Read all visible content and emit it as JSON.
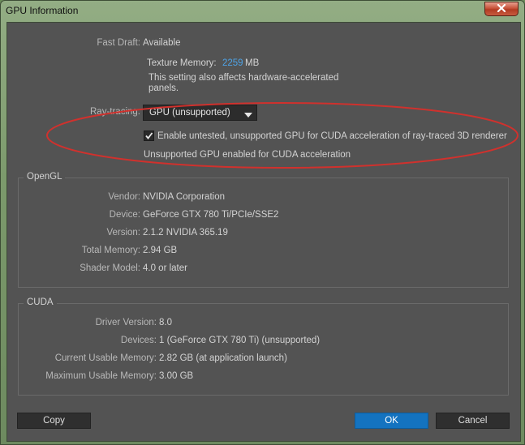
{
  "window": {
    "title": "GPU Information"
  },
  "icons": {
    "close": "close-icon",
    "dropdown": "chevron-down-icon",
    "check": "checkmark-icon"
  },
  "fast_draft": {
    "label": "Fast Draft:",
    "value": "Available"
  },
  "texture_memory": {
    "label": "Texture Memory:",
    "value": "2259",
    "unit": "MB"
  },
  "hw_note": {
    "line1": "This setting also affects hardware-accelerated",
    "line2": "panels."
  },
  "ray_tracing": {
    "label": "Ray-tracing:",
    "selected": "GPU (unsupported)"
  },
  "cuda_checkbox": {
    "checked": true,
    "label": "Enable untested, unsupported GPU for CUDA acceleration of ray-traced 3D renderer"
  },
  "cuda_status": "Unsupported GPU enabled for CUDA acceleration",
  "opengl": {
    "title": "OpenGL",
    "rows": [
      {
        "label": "Vendor:",
        "value": "NVIDIA Corporation"
      },
      {
        "label": "Device:",
        "value": "GeForce GTX 780 Ti/PCIe/SSE2"
      },
      {
        "label": "Version:",
        "value": "2.1.2 NVIDIA 365.19"
      },
      {
        "label": "Total Memory:",
        "value": "2.94 GB"
      },
      {
        "label": "Shader Model:",
        "value": "4.0 or later"
      }
    ]
  },
  "cuda": {
    "title": "CUDA",
    "rows": [
      {
        "label": "Driver Version:",
        "value": "8.0"
      },
      {
        "label": "Devices:",
        "value": "1 (GeForce GTX 780 Ti) (unsupported)"
      },
      {
        "label": "Current Usable Memory:",
        "value": "2.82 GB (at application launch)"
      },
      {
        "label": "Maximum Usable Memory:",
        "value": "3.00 GB"
      }
    ]
  },
  "buttons": {
    "copy": "Copy",
    "ok": "OK",
    "cancel": "Cancel"
  },
  "colors": {
    "accent": "#4ea3e6",
    "ok_button": "#1473c0",
    "annotation": "#d0312d",
    "panel": "#535353"
  }
}
